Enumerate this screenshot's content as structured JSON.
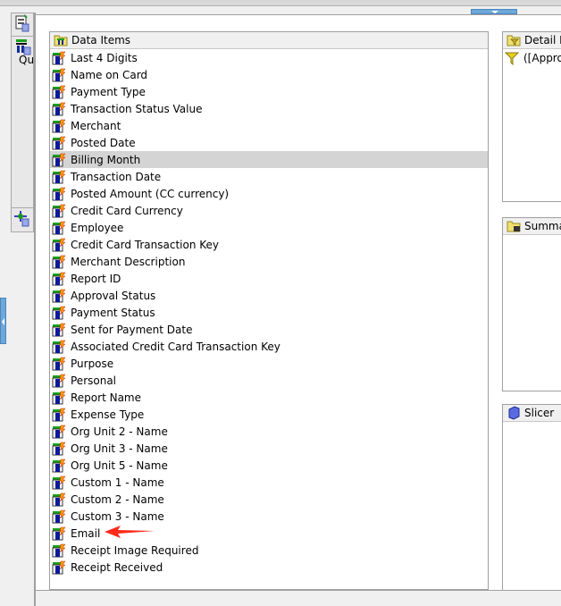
{
  "toolbar": {
    "query_label": "Qu"
  },
  "data_items": {
    "title": "Data Items",
    "selected": "Billing Month",
    "items": [
      "Last 4 Digits",
      "Name on Card",
      "Payment Type",
      "Transaction Status Value",
      "Merchant",
      "Posted Date",
      "Billing Month",
      "Transaction Date",
      "Posted Amount (CC currency)",
      "Credit Card Currency",
      "Employee",
      "Credit Card Transaction Key",
      "Merchant Description",
      "Report ID",
      "Approval Status",
      "Payment Status",
      "Sent for Payment Date",
      "Associated Credit Card Transaction Key",
      "Purpose",
      "Personal",
      "Report Name",
      "Expense Type",
      "Org Unit 2 - Name",
      "Org Unit 3 - Name",
      "Org Unit 5 - Name",
      "Custom 1 - Name",
      "Custom 2 - Name",
      "Custom 3 - Name",
      "Email",
      "Receipt Image Required",
      "Receipt Received"
    ]
  },
  "detail_filters": {
    "title": "Detail Fil",
    "items": [
      "([Approv"
    ]
  },
  "summary": {
    "title": "Summar"
  },
  "slicer": {
    "title": "Slicer"
  },
  "annotation": {
    "color": "#ff2a1a",
    "points_to": "Email"
  }
}
